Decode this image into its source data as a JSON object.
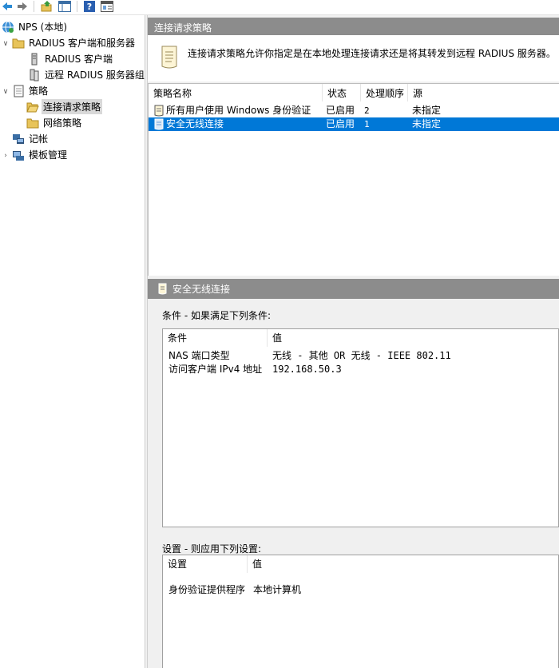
{
  "toolbar": {
    "buttons": [
      "back-icon",
      "forward-icon",
      "up-icon",
      "show-hide-tree-icon",
      "help-icon",
      "properties-icon"
    ]
  },
  "tree": {
    "items": [
      {
        "label": "NPS (本地)"
      },
      {
        "label": "RADIUS 客户端和服务器"
      },
      {
        "label": "RADIUS 客户端"
      },
      {
        "label": "远程 RADIUS 服务器组"
      },
      {
        "label": "策略"
      },
      {
        "label": "连接请求策略"
      },
      {
        "label": "网络策略"
      },
      {
        "label": "记帐"
      },
      {
        "label": "模板管理"
      }
    ]
  },
  "main": {
    "title": "连接请求策略",
    "description": "连接请求策略允许你指定是在本地处理连接请求还是将其转发到远程 RADIUS 服务器。",
    "columns": [
      "策略名称",
      "状态",
      "处理顺序",
      "源"
    ],
    "rows": [
      {
        "name": "所有用户使用 Windows 身份验证",
        "status": "已启用",
        "order": "2",
        "source": "未指定"
      },
      {
        "name": "安全无线连接",
        "status": "已启用",
        "order": "1",
        "source": "未指定"
      }
    ],
    "detail_title": "安全无线连接",
    "conditions_label": "条件 - 如果满足下列条件:",
    "conditions_columns": [
      "条件",
      "值"
    ],
    "conditions": [
      {
        "name": "NAS 端口类型",
        "value": "无线 - 其他 OR 无线 - IEEE 802.11"
      },
      {
        "name": "访问客户端 IPv4 地址",
        "value": "192.168.50.3"
      }
    ],
    "settings_label": "设置 - 则应用下列设置:",
    "settings_columns": [
      "设置",
      "值"
    ],
    "settings": [
      {
        "name": "身份验证提供程序",
        "value": "本地计算机"
      }
    ]
  },
  "colors": {
    "header_gray": "#8c8c8c",
    "selection_blue": "#0078d7",
    "tree_selection": "#d9d9d9",
    "folder_yellow": "#e8c45a"
  }
}
